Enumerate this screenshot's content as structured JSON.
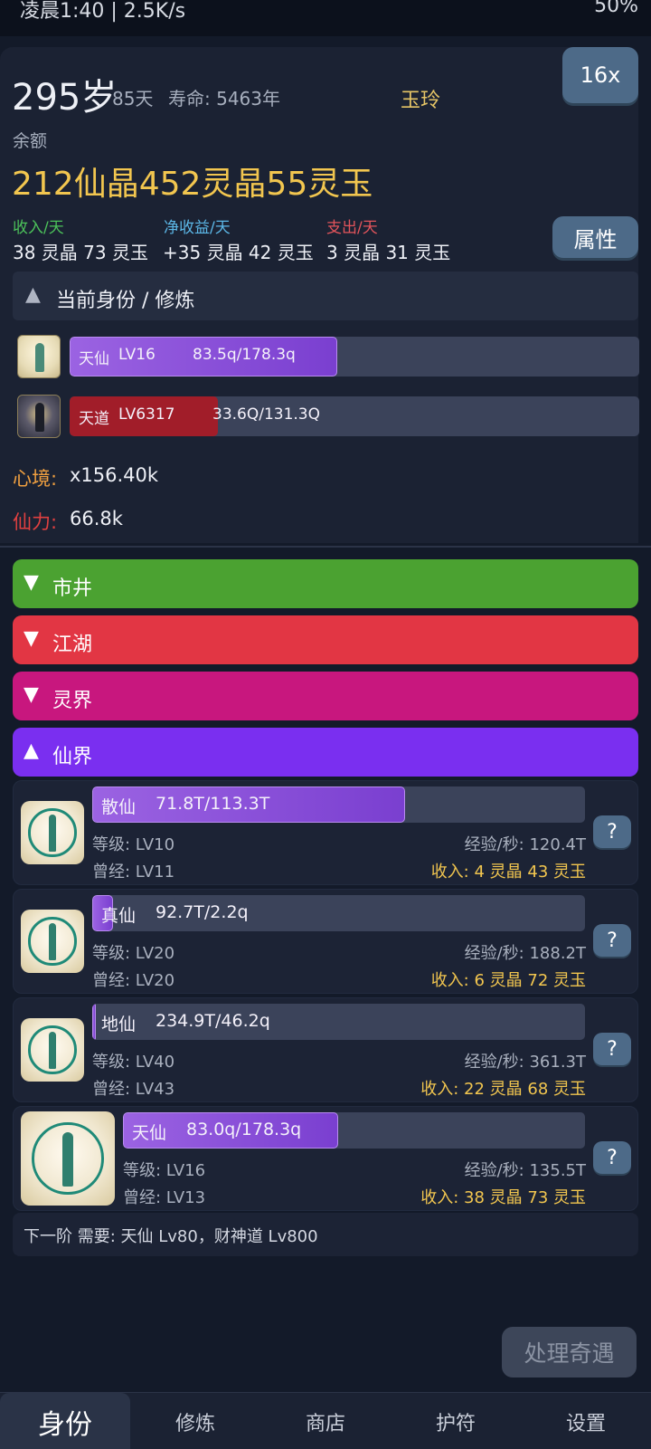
{
  "statusbar": {
    "time": "凌晨1:40 | 2.5K/s",
    "right": "50%"
  },
  "header": {
    "age": "295岁",
    "days": "85天",
    "lifespan": "寿命: 5463年",
    "name": "玉玲",
    "speed_label": "16x",
    "balance_label": "余额",
    "balance": "212仙晶452灵晶55灵玉",
    "income_label": "收入/天",
    "income_value": "38 灵晶 73 灵玉",
    "net_label": "净收益/天",
    "net_value": "+35 灵晶 42 灵玉",
    "expense_label": "支出/天",
    "expense_value": "3 灵晶 31 灵玉",
    "attr_button": "属性"
  },
  "identity": {
    "title": "当前身份 / 修炼",
    "rows": [
      {
        "name": "天仙",
        "level": "LV16",
        "progress": "83.5q/178.3q",
        "fill": 0.47,
        "color": "purple"
      },
      {
        "name": "天道",
        "level": "LV6317",
        "progress": "33.6Q/131.3Q",
        "fill": 0.26,
        "color": "red"
      }
    ],
    "mood_label": "心境:",
    "mood_value": "x156.40k",
    "power_label": "仙力:",
    "power_value": "66.8k"
  },
  "realms": [
    {
      "label": "市井",
      "arrow": "▼",
      "color": "#4ba231"
    },
    {
      "label": "江湖",
      "arrow": "▼",
      "color": "#e23644"
    },
    {
      "label": "灵界",
      "arrow": "▼",
      "color": "#c8177e"
    },
    {
      "label": "仙界",
      "arrow": "▲",
      "color": "#7a2ff0"
    }
  ],
  "tiers": [
    {
      "name": "散仙",
      "progress": "71.8T/113.3T",
      "fill": 0.634,
      "level": "等级: LV10",
      "past": "曾经: LV11",
      "rate": "经验/秒: 120.4T",
      "income": "收入: 4 灵晶 43 灵玉",
      "help": "?"
    },
    {
      "name": "真仙",
      "progress": "92.7T/2.2q",
      "fill": 0.042,
      "level": "等级: LV20",
      "past": "曾经: LV20",
      "rate": "经验/秒: 188.2T",
      "income": "收入: 6 灵晶 72 灵玉",
      "help": "?"
    },
    {
      "name": "地仙",
      "progress": "234.9T/46.2q",
      "fill": 0.005,
      "level": "等级: LV40",
      "past": "曾经: LV43",
      "rate": "经验/秒: 361.3T",
      "income": "收入: 22 灵晶 68 灵玉",
      "help": "?"
    },
    {
      "name": "天仙",
      "progress": "83.0q/178.3q",
      "fill": 0.465,
      "level": "等级: LV16",
      "past": "曾经: LV13",
      "rate": "经验/秒: 135.5T",
      "income": "收入: 38 灵晶 73 灵玉",
      "help": "?"
    }
  ],
  "next_requirement": "下一阶 需要: 天仙 Lv80，财神道 Lv800",
  "event_button": "处理奇遇",
  "nav": [
    "身份",
    "修炼",
    "商店",
    "护符",
    "设置"
  ],
  "colors": {
    "gold": "#f2c64f",
    "income_green": "#4cc25a",
    "net_blue": "#5cb8e8",
    "expense_red": "#e2545b",
    "mood_orange": "#f0a040",
    "power_red": "#e04040"
  }
}
